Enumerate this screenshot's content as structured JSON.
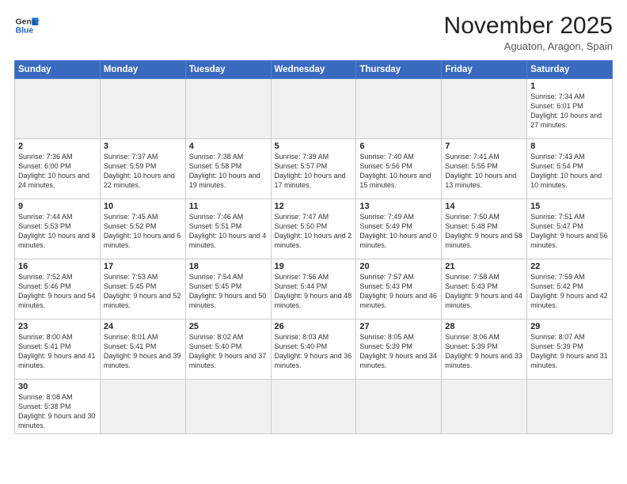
{
  "header": {
    "logo_general": "General",
    "logo_blue": "Blue",
    "month_title": "November 2025",
    "location": "Aguaton, Aragon, Spain"
  },
  "weekdays": [
    "Sunday",
    "Monday",
    "Tuesday",
    "Wednesday",
    "Thursday",
    "Friday",
    "Saturday"
  ],
  "weeks": [
    [
      {
        "day": "",
        "info": ""
      },
      {
        "day": "",
        "info": ""
      },
      {
        "day": "",
        "info": ""
      },
      {
        "day": "",
        "info": ""
      },
      {
        "day": "",
        "info": ""
      },
      {
        "day": "",
        "info": ""
      },
      {
        "day": "1",
        "info": "Sunrise: 7:34 AM\nSunset: 6:01 PM\nDaylight: 10 hours\nand 27 minutes."
      }
    ],
    [
      {
        "day": "2",
        "info": "Sunrise: 7:36 AM\nSunset: 6:00 PM\nDaylight: 10 hours\nand 24 minutes."
      },
      {
        "day": "3",
        "info": "Sunrise: 7:37 AM\nSunset: 5:59 PM\nDaylight: 10 hours\nand 22 minutes."
      },
      {
        "day": "4",
        "info": "Sunrise: 7:38 AM\nSunset: 5:58 PM\nDaylight: 10 hours\nand 19 minutes."
      },
      {
        "day": "5",
        "info": "Sunrise: 7:39 AM\nSunset: 5:57 PM\nDaylight: 10 hours\nand 17 minutes."
      },
      {
        "day": "6",
        "info": "Sunrise: 7:40 AM\nSunset: 5:56 PM\nDaylight: 10 hours\nand 15 minutes."
      },
      {
        "day": "7",
        "info": "Sunrise: 7:41 AM\nSunset: 5:55 PM\nDaylight: 10 hours\nand 13 minutes."
      },
      {
        "day": "8",
        "info": "Sunrise: 7:43 AM\nSunset: 5:54 PM\nDaylight: 10 hours\nand 10 minutes."
      }
    ],
    [
      {
        "day": "9",
        "info": "Sunrise: 7:44 AM\nSunset: 5:53 PM\nDaylight: 10 hours\nand 8 minutes."
      },
      {
        "day": "10",
        "info": "Sunrise: 7:45 AM\nSunset: 5:52 PM\nDaylight: 10 hours\nand 6 minutes."
      },
      {
        "day": "11",
        "info": "Sunrise: 7:46 AM\nSunset: 5:51 PM\nDaylight: 10 hours\nand 4 minutes."
      },
      {
        "day": "12",
        "info": "Sunrise: 7:47 AM\nSunset: 5:50 PM\nDaylight: 10 hours\nand 2 minutes."
      },
      {
        "day": "13",
        "info": "Sunrise: 7:49 AM\nSunset: 5:49 PM\nDaylight: 10 hours\nand 0 minutes."
      },
      {
        "day": "14",
        "info": "Sunrise: 7:50 AM\nSunset: 5:48 PM\nDaylight: 9 hours\nand 58 minutes."
      },
      {
        "day": "15",
        "info": "Sunrise: 7:51 AM\nSunset: 5:47 PM\nDaylight: 9 hours\nand 56 minutes."
      }
    ],
    [
      {
        "day": "16",
        "info": "Sunrise: 7:52 AM\nSunset: 5:46 PM\nDaylight: 9 hours\nand 54 minutes."
      },
      {
        "day": "17",
        "info": "Sunrise: 7:53 AM\nSunset: 5:45 PM\nDaylight: 9 hours\nand 52 minutes."
      },
      {
        "day": "18",
        "info": "Sunrise: 7:54 AM\nSunset: 5:45 PM\nDaylight: 9 hours\nand 50 minutes."
      },
      {
        "day": "19",
        "info": "Sunrise: 7:56 AM\nSunset: 5:44 PM\nDaylight: 9 hours\nand 48 minutes."
      },
      {
        "day": "20",
        "info": "Sunrise: 7:57 AM\nSunset: 5:43 PM\nDaylight: 9 hours\nand 46 minutes."
      },
      {
        "day": "21",
        "info": "Sunrise: 7:58 AM\nSunset: 5:43 PM\nDaylight: 9 hours\nand 44 minutes."
      },
      {
        "day": "22",
        "info": "Sunrise: 7:59 AM\nSunset: 5:42 PM\nDaylight: 9 hours\nand 42 minutes."
      }
    ],
    [
      {
        "day": "23",
        "info": "Sunrise: 8:00 AM\nSunset: 5:41 PM\nDaylight: 9 hours\nand 41 minutes."
      },
      {
        "day": "24",
        "info": "Sunrise: 8:01 AM\nSunset: 5:41 PM\nDaylight: 9 hours\nand 39 minutes."
      },
      {
        "day": "25",
        "info": "Sunrise: 8:02 AM\nSunset: 5:40 PM\nDaylight: 9 hours\nand 37 minutes."
      },
      {
        "day": "26",
        "info": "Sunrise: 8:03 AM\nSunset: 5:40 PM\nDaylight: 9 hours\nand 36 minutes."
      },
      {
        "day": "27",
        "info": "Sunrise: 8:05 AM\nSunset: 5:39 PM\nDaylight: 9 hours\nand 34 minutes."
      },
      {
        "day": "28",
        "info": "Sunrise: 8:06 AM\nSunset: 5:39 PM\nDaylight: 9 hours\nand 33 minutes."
      },
      {
        "day": "29",
        "info": "Sunrise: 8:07 AM\nSunset: 5:39 PM\nDaylight: 9 hours\nand 31 minutes."
      }
    ],
    [
      {
        "day": "30",
        "info": "Sunrise: 8:08 AM\nSunset: 5:38 PM\nDaylight: 9 hours\nand 30 minutes."
      },
      {
        "day": "",
        "info": ""
      },
      {
        "day": "",
        "info": ""
      },
      {
        "day": "",
        "info": ""
      },
      {
        "day": "",
        "info": ""
      },
      {
        "day": "",
        "info": ""
      },
      {
        "day": "",
        "info": ""
      }
    ]
  ]
}
